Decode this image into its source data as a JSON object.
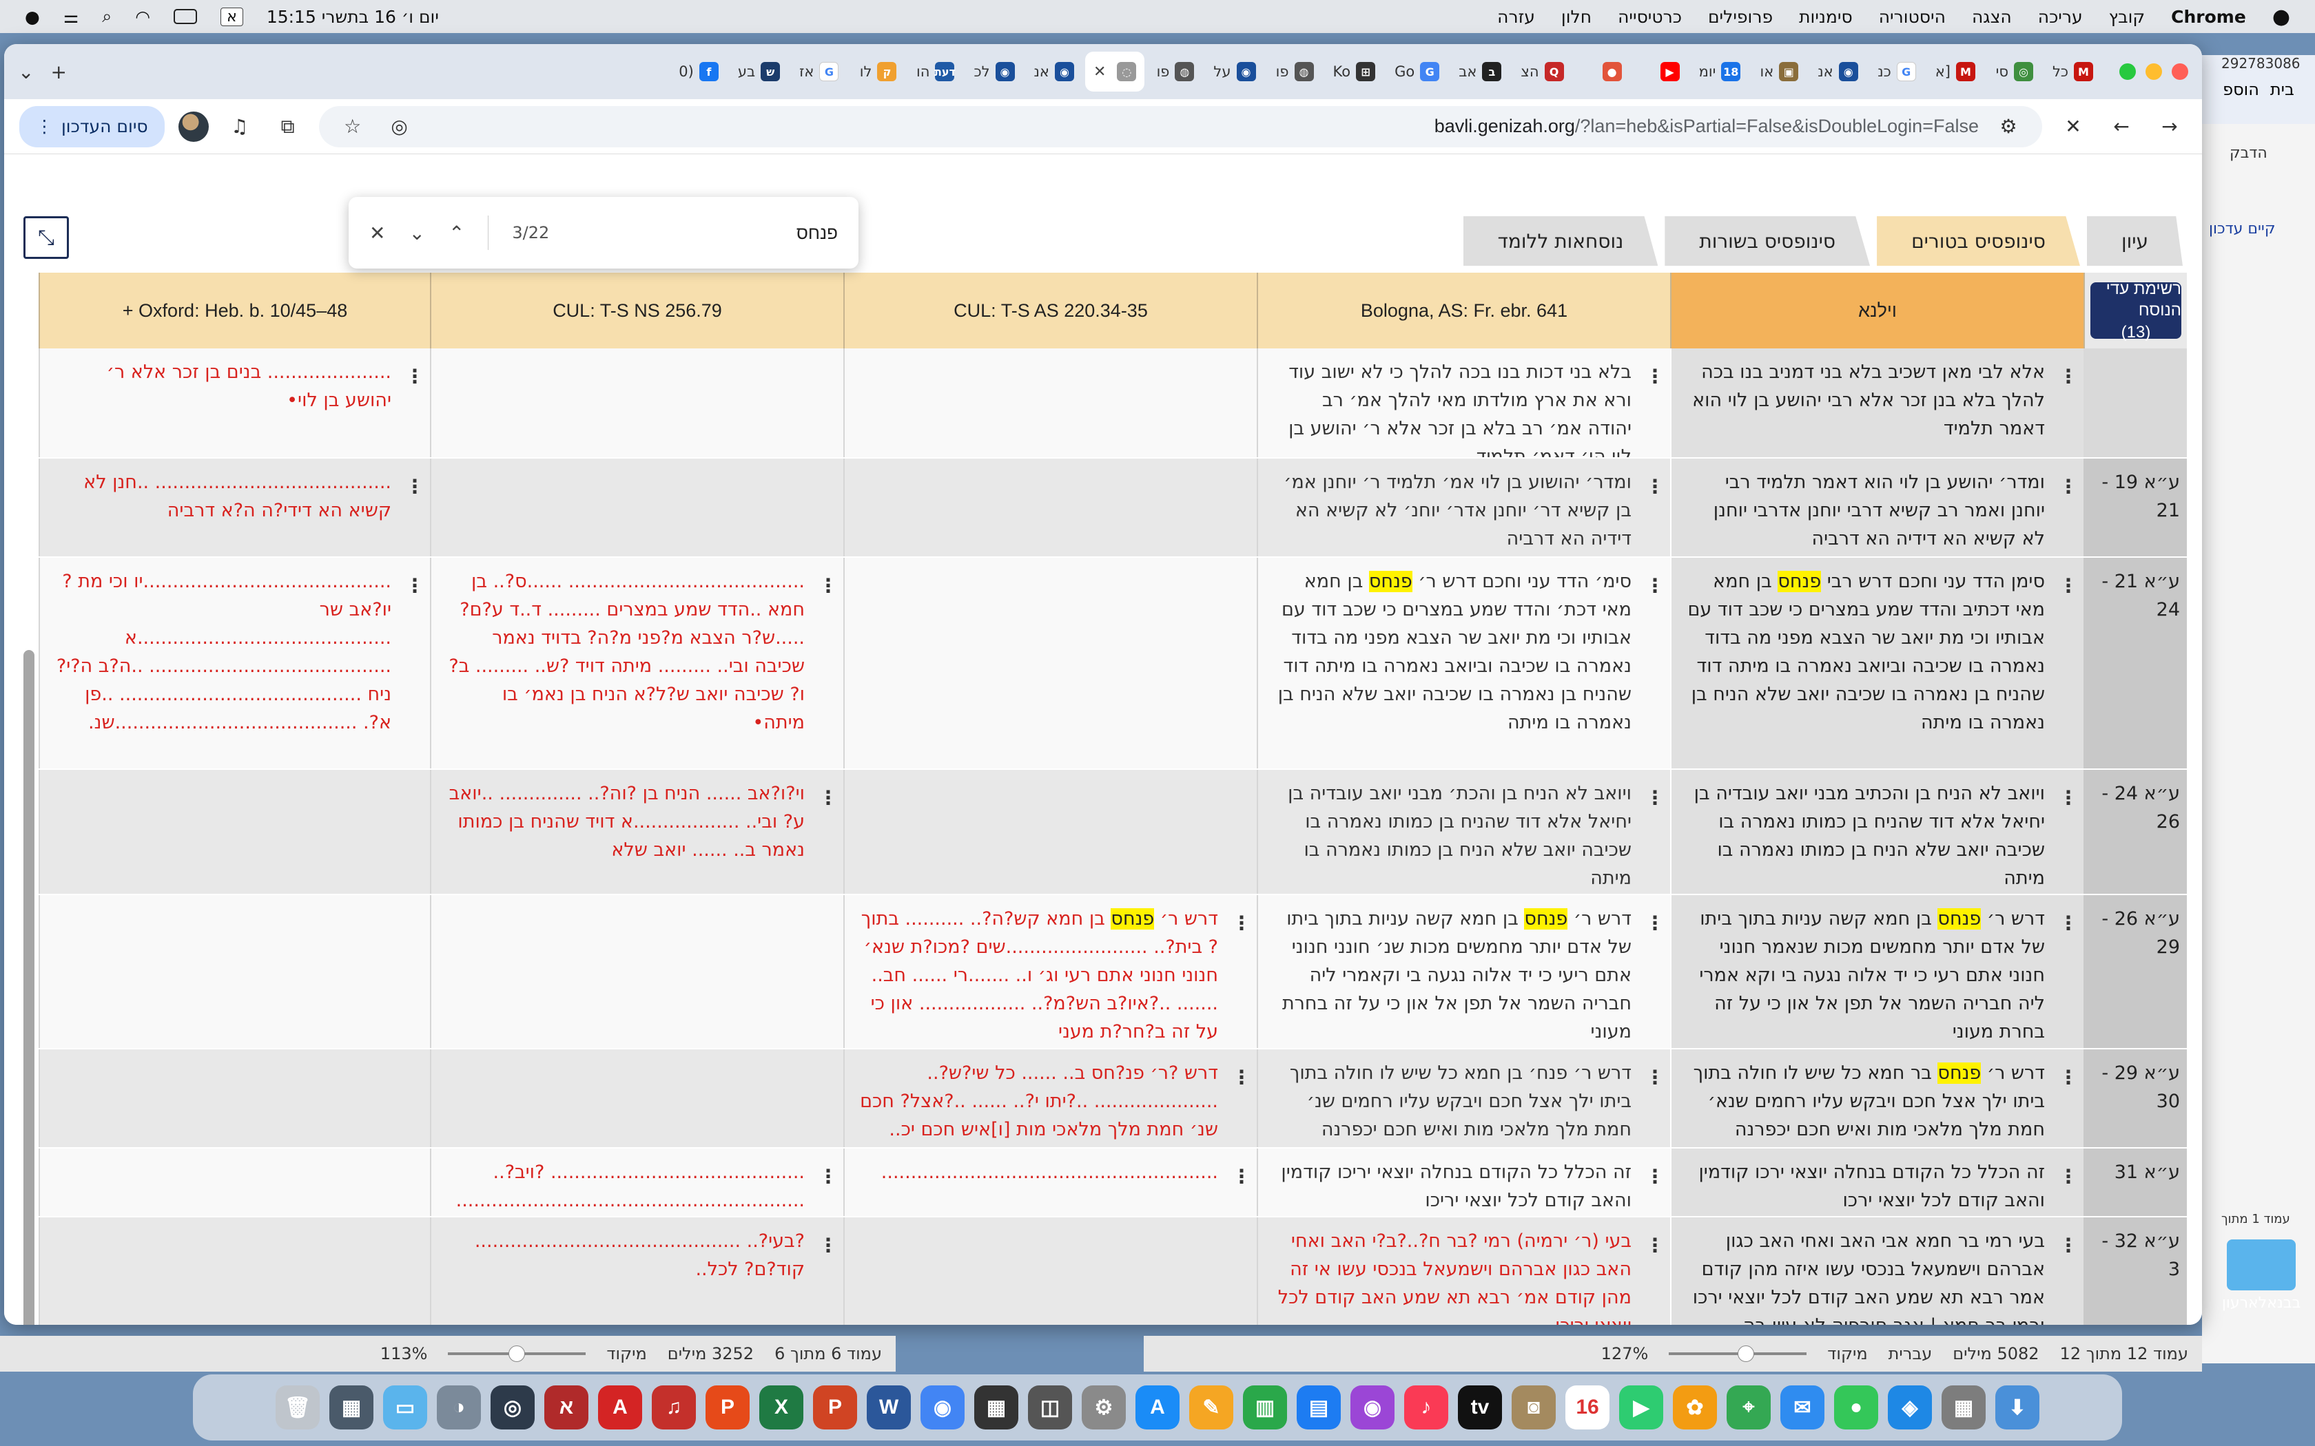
{
  "menubar": {
    "apple": "",
    "app": "Chrome",
    "items": [
      "קובץ",
      "עריכה",
      "הצגה",
      "היסטוריה",
      "סימניות",
      "פרופילים",
      "כרטיסייה",
      "חלון",
      "עזרה"
    ],
    "clock": "יום ו׳ 16 בתשרי 15:15",
    "keyboard": "א"
  },
  "tabs": [
    {
      "label": "כל",
      "color": "#c71610",
      "glyph": "M"
    },
    {
      "label": "סי",
      "color": "#3f8f3f",
      "glyph": "◎"
    },
    {
      "label": "[א",
      "color": "#c71610",
      "glyph": "M"
    },
    {
      "label": "כנ",
      "color": "#ffffff",
      "glyph": "G"
    },
    {
      "label": "אנ",
      "color": "#1a4f9b",
      "glyph": "◉"
    },
    {
      "label": "או",
      "color": "#8a6d3b",
      "glyph": "▣"
    },
    {
      "label": "יומ",
      "color": "#1a73e8",
      "glyph": "18"
    },
    {
      "label": "",
      "color": "#ff0000",
      "glyph": "▶"
    },
    {
      "label": "",
      "color": "#e2543b",
      "glyph": "●"
    },
    {
      "label": "הצ",
      "color": "#c62828",
      "glyph": "Q"
    },
    {
      "label": "אב",
      "color": "#222222",
      "glyph": "ב"
    },
    {
      "label": "Go",
      "color": "#4285f4",
      "glyph": "G"
    },
    {
      "label": "Ko",
      "color": "#333333",
      "glyph": "⊞"
    },
    {
      "label": "פו",
      "color": "#555555",
      "glyph": "◍"
    },
    {
      "label": "על",
      "color": "#1a4f9b",
      "glyph": "◉"
    },
    {
      "label": "פו",
      "color": "#555555",
      "glyph": "◍"
    },
    {
      "label": "",
      "color": "#999999",
      "glyph": "◌",
      "active": true
    },
    {
      "label": "אנ",
      "color": "#1a4f9b",
      "glyph": "◉"
    },
    {
      "label": "לכ",
      "color": "#1a4f9b",
      "glyph": "◉"
    },
    {
      "label": "הו",
      "color": "#1f5aa6",
      "glyph": "דעת"
    },
    {
      "label": "לו",
      "color": "#f0a030",
      "glyph": "ק"
    },
    {
      "label": "אז",
      "color": "#ffffff",
      "glyph": "G"
    },
    {
      "label": "בע",
      "color": "#1b3c6b",
      "glyph": "ש"
    },
    {
      "label": "(0",
      "color": "#1877f2",
      "glyph": "f"
    }
  ],
  "toolbar": {
    "url_main": "bavli.genizah.org",
    "url_rest": "/?lan=heb&isPartial=False&isDoubleLogin=False",
    "update_label": "סיום העדכון"
  },
  "find": {
    "query": "פנחס",
    "count": "3/22"
  },
  "view_tabs": [
    "עיון",
    "סינופסיס בטורים",
    "סינופסיס בשורות",
    "נוסחאות ללומד"
  ],
  "selected_view_tab": 1,
  "columns": {
    "witness_list_line1": "רשימת עדי הנוסח",
    "witness_list_line2": "(13)",
    "vilna": "וילנא",
    "c1": "Bologna, AS: Fr. ebr. 641",
    "c2": "CUL: T-S AS 220.34-35",
    "c3": "CUL: T-S NS 256.79",
    "c4": "Oxford: Heb. b. 10/45–48 +"
  },
  "rows": [
    {
      "ref": "",
      "vilna": "אלא לבי מאן דשכיב בלא בני דמניב בנו בכה להלך בלא בנן זכר אלא רבי יהושע בן לוי הוא דאמר תלמיד",
      "c1": "בלא בני דכות בנו בכה להלך כי לא ישוב עוד ורא את ארץ מולדתו מאי להלך אמ׳ רב יהודה אמ׳ רב בלא בן זכר אלא ר׳ יהושע בן לוי הו׳ דאמ׳ תלמיד",
      "c2": "",
      "c3": "",
      "c4": "..................... בנים בן זכר אלא ר׳ יהושע בן לוי•"
    },
    {
      "ref": "ע״א 19 - 21",
      "vilna": "ומדר׳ יהושע בן לוי הוא דאמר תלמיד רבי יוחנן ואמר רב קשיא דרבי יוחנן אדרבי יוחנן לא קשיא הא דידיה הא דרביה",
      "c1": "ומדר׳ יהושוע בן לוי אמ׳ תלמיד ר׳ יוחנן אמ׳ בן קשיא דר׳ יוחנן אדר׳ יוחנ׳ לא קשיא הא דידיה הא דרביה",
      "c2": "",
      "c3": "",
      "c4": "........................................ ..חנן לא קשיא הא דידי?ה ה?א דרביה"
    },
    {
      "ref": "ע״א 21 - 24",
      "vilna": "סימן הדד עני וחכם דרש רבי פנחס בן חמא מאי דכתיב והדד שמע במצרים כי שכב דוד עם אבותיו וכי מת יואב שר הצבא מפני מה בדוד נאמרה בו שכיבה וביואב נאמרה בו מיתה דוד שהניח בן נאמרה בו שכיבה יואב שלא הניח בן נאמרה בו מיתה",
      "c1": "סימ׳ הדד עני וחכם דרש ר׳ פנחס בן חמא מאי דכת׳ והדד שמע במצרים כי שכב דוד עם אבותיו וכי מת יואב שר הצבא מפני מה בדוד נאמרה בו שכיבה וביואב נאמרה בו מיתה דוד שהניח בן נאמרה בו שכיבה יואב שלא הניח בן נאמרה בו מיתה",
      "c2": "",
      "c3": "........................................ ......ס?.. בן חמא ..הדד שמע במצרים ......... ד..ד ע?ם? .....ש?ר הצבא מ?פני מ?ה? בדויד נאמר שכיבה ובי.. ......... מיתה דויד ?ש.. ......... ב?ו? שכיבה יואב ש?ל?א הניח בן נאמ׳ בו מיתה•",
      "c4": "..........................................יו וכי מת ? יו?אב שר ...........................................א ......................................... ..ה?ב ה?י?ניח ......................................... ..פן א?. .........................................שנ."
    },
    {
      "ref": "ע״א 24 - 26",
      "vilna": "ויואב לא הניח בן והכתיב מבני יואב עובדיה בן יחיאל אלא דוד שהניח בן כמותו נאמרה בו שכיבה יואב שלא הניח בן כמותו נאמרה בו מיתה",
      "c1": "ויואב לא הניח בן והכת׳ מבני יואב עובדיה בן יחיאל אלא דוד שהניח בן כמותו נאמרה בו שכיבה יואב שלא הניח בן כמותו נאמרה בו מיתה",
      "c2": "",
      "c3": "וי?ו?אב ...... הניח בן ?וה?.. .............. ..יואב ע? ובי.. ..................א דויד שהניח בן כמותו נאמר ב.. ...... יואב שלא",
      "c4": ""
    },
    {
      "ref": "ע״א 26 - 29",
      "vilna": "דרש ר׳ פנחס בן חמא קשה עניות בתוך ביתו של אדם יותר מחמשים מכות שנאמר חנוני חנוני אתם רעי כי יד אלוה נגעה בי וקא אמרי ליה חבריה השמר אל תפן אל און כי על זה בחרת מעוני",
      "c1": "דרש ר׳ פנחס בן חמא קשה עניות בתוך ביתו של אדם יותר מחמשים מכות שנ׳ חונני חנוני אתם ריעי כי יד אלוה נגעה בי וקאמרי ליה חבריה השמר אל תפן אל און כי על זה בחרת מעוני",
      "c2": "דרש ר׳ פנחס בן חמא קש?ה?.. .......... בתוך ? בית?.. ........................שים ?מכו?ת שנא׳ חנוני חנוני אתם רעי וג׳ ו.. .......רי ...... חב.. ....... ..?איו?ב הש?מ?.. .................. און כי על זה ב?חר?ת מעני",
      "c3": "",
      "c4": ""
    },
    {
      "ref": "ע״א 29 - 30",
      "vilna": "דרש ר׳ פנחס בר חמא כל שיש לו חולה בתוך ביתו ילך אצל חכם ויבקש עליו רחמים שנא׳ חמת מלך מלאכי מות ואיש חכם יכפרנה",
      "c1": "דרש ר׳ פנח׳ בן חמא כל שיש לו חולה בתוך ביתו ילך אצל חכם ויבקש עליו רחמים שנ׳ חמת מלך מלאכי מות ואיש חכם יכפרנה",
      "c2": "דרש ?ר׳ פנ?חס ב.. ...... כל שי?ש?.. ..................... ..?יתו י?.. ...... ..?אצל? חכם שנ׳ חמת מלך מלאכי מות [ו]איש חכם יכ.. ......",
      "c3": "",
      "c4": ""
    },
    {
      "ref": "ע״א 31",
      "vilna": "זה הכלל כל הקודם בנחלה יוצאי ירכו קודמין והאב קודם לכל יוצאי ירכו",
      "c1": "זה הכלל כל הקודם בנחלה יוצאי יריכו קודמין והאב קודם לכל יוצאי יריכו",
      "c2": ".........................................................",
      "c3": "........................................... ?ויב?..  ...........................................................",
      "c4": ""
    },
    {
      "ref": "ע״א 32 - 3",
      "vilna": "בעי רמי בר חמא אבי האב ואחי האב כגון אברהם וישמעאל בנכסי עשו איזה מהן קודם אמר רבא תא שמע האב קודם לכל יוצאי ירכו ורמי בר חמא | אגב חורפיה לא עיין בה",
      "c1": "בעי (ר׳ ירמיה) רמי ?בר ח?..?ב?י האב ואחי האב כגון אברהם וישמעאל בנכסי עשו אי זה מהן קודם אמ׳ רבא תא שמע האב קודם לכל יוצאי יריכו",
      "c2": "",
      "c3": "?בעי?.. ............................................. קוד?ם? לכל..",
      "c4": ""
    }
  ],
  "word_left": {
    "page": "עמוד 6 מתוך 6",
    "words": "3252 מילים",
    "focus": "מיקוד",
    "zoom": "113%"
  },
  "word_right": {
    "page": "עמוד 12 מתוך 12",
    "words": "5082 מילים",
    "lang": "עברית",
    "focus": "מיקוד",
    "zoom": "127%",
    "ribbon": "הדבק",
    "tab1": "בית",
    "tab2": "הוספ",
    "status_note": "קיים עדכון",
    "page_note": "עמוד 1 מתוך",
    "side_num": "292783086"
  },
  "desktop_folder": "בבנאלארעון",
  "dock": [
    {
      "name": "trash",
      "color": "#bfc5cc",
      "glyph": "🗑"
    },
    {
      "name": "finder-files",
      "color": "#4a5a6a",
      "glyph": "▦"
    },
    {
      "name": "folder",
      "color": "#5ab4ec",
      "glyph": "▭"
    },
    {
      "name": "photo",
      "color": "#7b8a9a",
      "glyph": "◑"
    },
    {
      "name": "quicktime",
      "color": "#2d3a4a",
      "glyph": "◎"
    },
    {
      "name": "alef",
      "color": "#b02a2a",
      "glyph": "א"
    },
    {
      "name": "acrobat",
      "color": "#d42424",
      "glyph": "A"
    },
    {
      "name": "audio",
      "color": "#c4302b",
      "glyph": "♫"
    },
    {
      "name": "pdf",
      "color": "#e64a19",
      "glyph": "P"
    },
    {
      "name": "excel",
      "color": "#1f7a43",
      "glyph": "X"
    },
    {
      "name": "powerpoint",
      "color": "#d04423",
      "glyph": "P"
    },
    {
      "name": "word",
      "color": "#2b579a",
      "glyph": "W"
    },
    {
      "name": "chrome",
      "color": "#4285f4",
      "glyph": "◉"
    },
    {
      "name": "calculator",
      "color": "#333333",
      "glyph": "▦"
    },
    {
      "name": "screenshot",
      "color": "#555555",
      "glyph": "◫"
    },
    {
      "name": "settings",
      "color": "#8a8a8a",
      "glyph": "⚙"
    },
    {
      "name": "appstore",
      "color": "#1a8cf7",
      "glyph": "A"
    },
    {
      "name": "pages",
      "color": "#f5a623",
      "glyph": "✎"
    },
    {
      "name": "numbers",
      "color": "#2aa84a",
      "glyph": "▥"
    },
    {
      "name": "keynote",
      "color": "#1d7cf2",
      "glyph": "▤"
    },
    {
      "name": "podcasts",
      "color": "#9b46d6",
      "glyph": "◉"
    },
    {
      "name": "music",
      "color": "#fa3a55",
      "glyph": "♪"
    },
    {
      "name": "tv",
      "color": "#111111",
      "glyph": "tv"
    },
    {
      "name": "contacts",
      "color": "#a48a5f",
      "glyph": "◙"
    },
    {
      "name": "calendar",
      "color": "#ffffff",
      "glyph": "16"
    },
    {
      "name": "facetime",
      "color": "#2ecc71",
      "glyph": "▶"
    },
    {
      "name": "photos",
      "color": "#f39c12",
      "glyph": "✿"
    },
    {
      "name": "maps",
      "color": "#34a853",
      "glyph": "⌖"
    },
    {
      "name": "mail",
      "color": "#2f8cf0",
      "glyph": "✉"
    },
    {
      "name": "messages",
      "color": "#34c759",
      "glyph": "●"
    },
    {
      "name": "safari",
      "color": "#1e88e5",
      "glyph": "◈"
    },
    {
      "name": "launchpad",
      "color": "#7d7d7d",
      "glyph": "▦"
    },
    {
      "name": "downloads",
      "color": "#4a90d9",
      "glyph": "⬇"
    }
  ],
  "colors": {
    "variant": "#d8221e",
    "highlight": "#fff200",
    "header": "#f7dfae",
    "vilna_header": "#f3b25a",
    "navy": "#1e3168"
  }
}
